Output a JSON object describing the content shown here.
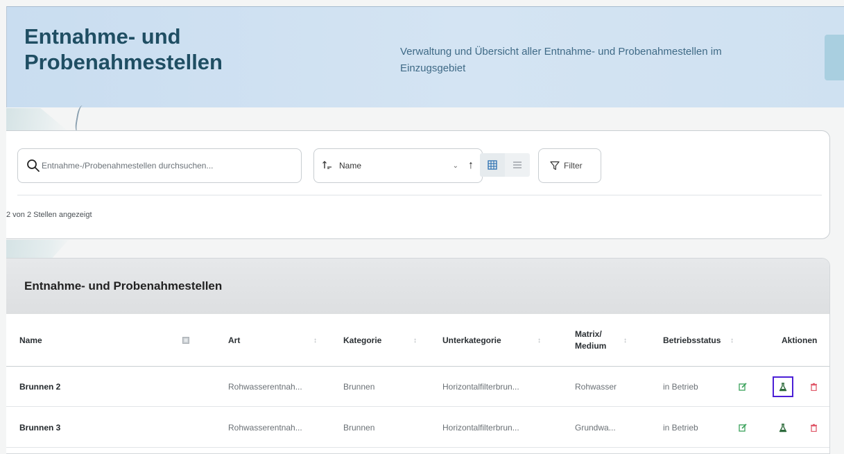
{
  "header": {
    "title": "Entnahme- und Probenahmestellen",
    "subtitle": "Verwaltung und Übersicht aller Entnahme- und Probenahmestellen im Einzugsgebiet"
  },
  "toolbar": {
    "search_placeholder": "Entnahme-/Probenahmestellen durchsuchen...",
    "sort_label": "Name",
    "filter_label": "Filter",
    "result_count": "2 von 2 Stellen angezeigt"
  },
  "table": {
    "title": "Entnahme- und Probenahmestellen",
    "columns": {
      "name": "Name",
      "art": "Art",
      "kategorie": "Kategorie",
      "unterkategorie": "Unterkategorie",
      "matrix_line1": "Matrix/",
      "matrix_line2": "Medium",
      "betriebsstatus": "Betriebsstatus",
      "aktionen": "Aktionen"
    },
    "rows": [
      {
        "name": "Brunnen 2",
        "art": "Rohwasserentnah...",
        "kategorie": "Brunnen",
        "unterkategorie": "Horizontalfilterbrun...",
        "matrix": "Rohwasser",
        "status": "in Betrieb"
      },
      {
        "name": "Brunnen 3",
        "art": "Rohwasserentnah...",
        "kategorie": "Brunnen",
        "unterkategorie": "Horizontalfilterbrun...",
        "matrix": "Grundwa...",
        "status": "in Betrieb"
      }
    ]
  },
  "colors": {
    "title": "#1f4e63",
    "edit_icon": "#3aa15a",
    "sample_icon": "#2e6b3c",
    "delete_icon": "#e05a6b",
    "highlight": "#4b1fd6"
  }
}
